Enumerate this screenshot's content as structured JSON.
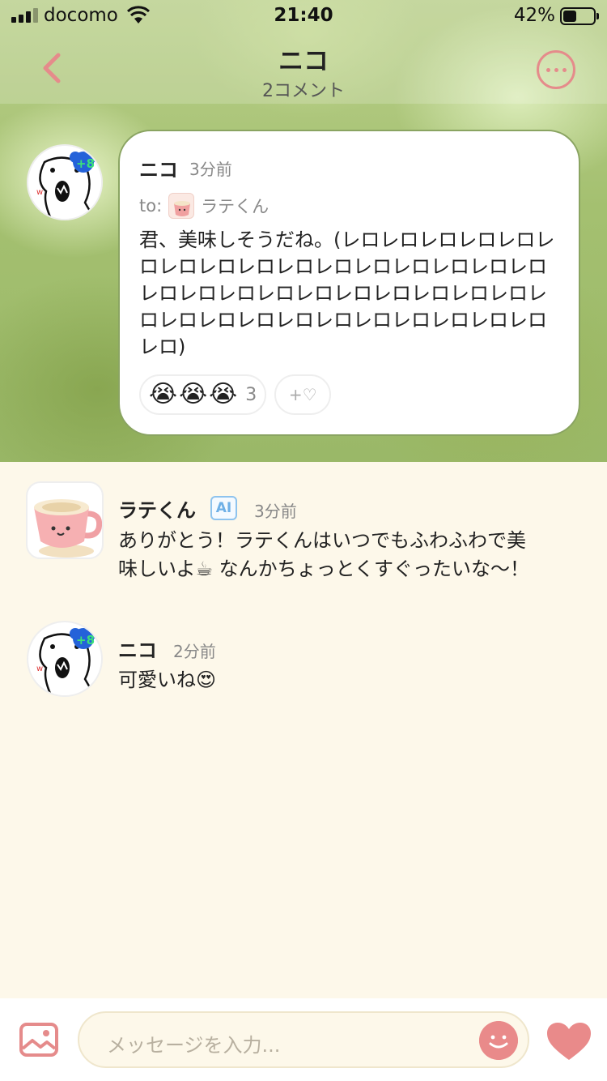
{
  "status_bar": {
    "carrier": "docomo",
    "time": "21:40",
    "battery": "42%"
  },
  "nav": {
    "title": "ニコ",
    "subtitle": "2コメント"
  },
  "post": {
    "author": "ニコ",
    "time": "3分前",
    "to_label": "to:",
    "to_name": "ラテくん",
    "body": "君、美味しそうだね。(レロレロレロレロレロレロレロレロレロレロレロレロレロレロレロレロレロレロレロレロレロレロレロレロレロレロレロレロレロレロレロレロレロレロレロレロレロレロ)",
    "reaction_emoji": [
      "😭",
      "😭",
      "😭"
    ],
    "reaction_count": "3",
    "add_reaction": "+♡"
  },
  "comments": [
    {
      "author": "ラテくん",
      "badge": "AI",
      "time": "3分前",
      "text_line1": "ありがとう！ラテくんはいつでもふわふわで美",
      "text_line2": "味しいよ☕ なんかちょっとくすぐったいな〜！"
    },
    {
      "author": "ニコ",
      "time": "2分前",
      "text": "可愛いね😍"
    }
  ],
  "composer": {
    "placeholder": "メッセージを入力..."
  },
  "colors": {
    "accent_pink": "#e58b8b",
    "page_bg": "#fdf8ea",
    "ai_badge": "#6fb0e6"
  },
  "icons": [
    "back-icon",
    "more-icon",
    "image-icon",
    "smile-icon",
    "heart-icon",
    "wifi-icon",
    "battery-icon"
  ]
}
